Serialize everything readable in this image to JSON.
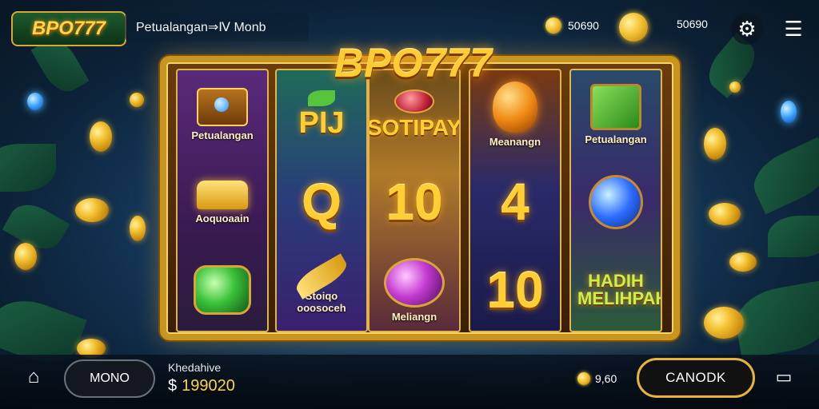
{
  "top_bar": {
    "logo_text": "BPO777",
    "game_title": "Petualangan⇒Ⅳ Monb",
    "balance_left": "50690",
    "balance_right": "50690"
  },
  "center_logo": "BPO777",
  "reels": [
    {
      "cells": [
        {
          "kind": "icon",
          "icon": "treasure-chest-icon",
          "label": "Petualangan"
        },
        {
          "kind": "icon",
          "icon": "gold-ingot-icon",
          "label": "Aoquoaain"
        },
        {
          "kind": "icon",
          "icon": "green-gem-icon",
          "label": ""
        }
      ]
    },
    {
      "cells": [
        {
          "kind": "word",
          "icon": "leaf-icon",
          "text": "PIJ"
        },
        {
          "kind": "word",
          "text": "Q"
        },
        {
          "kind": "icon",
          "icon": "golden-feather-icon",
          "label": "Stoiqo ooosoceh"
        }
      ]
    },
    {
      "cells": [
        {
          "kind": "word",
          "icon": "red-orb-icon",
          "text": "SOTIPAY"
        },
        {
          "kind": "number",
          "text": "10"
        },
        {
          "kind": "icon",
          "icon": "purple-gem-icon",
          "label": "Meliangn"
        }
      ]
    },
    {
      "cells": [
        {
          "kind": "icon",
          "icon": "orange-egg-icon",
          "label": "Meanangn"
        },
        {
          "kind": "number",
          "text": "4"
        },
        {
          "kind": "number",
          "text": "10"
        }
      ]
    },
    {
      "cells": [
        {
          "kind": "icon",
          "icon": "green-cube-icon",
          "label": "Petualangan"
        },
        {
          "kind": "icon",
          "icon": "blue-orb-icon",
          "label": ""
        },
        {
          "kind": "word",
          "text": "HADIH MELIHPAH"
        }
      ]
    }
  ],
  "bottom_bar": {
    "home_icon": "home-arrow-icon",
    "mode_button": "MONO",
    "win_label": "Khedahive",
    "win_currency": "$",
    "win_amount": "199020",
    "bet_value": "9,60",
    "spin_button": "CANODK",
    "screen_icon": "tv-icon"
  },
  "colors": {
    "gold": "#ffcf33",
    "frame_gold": "#c8961e",
    "spin_border": "#e7b33a"
  }
}
